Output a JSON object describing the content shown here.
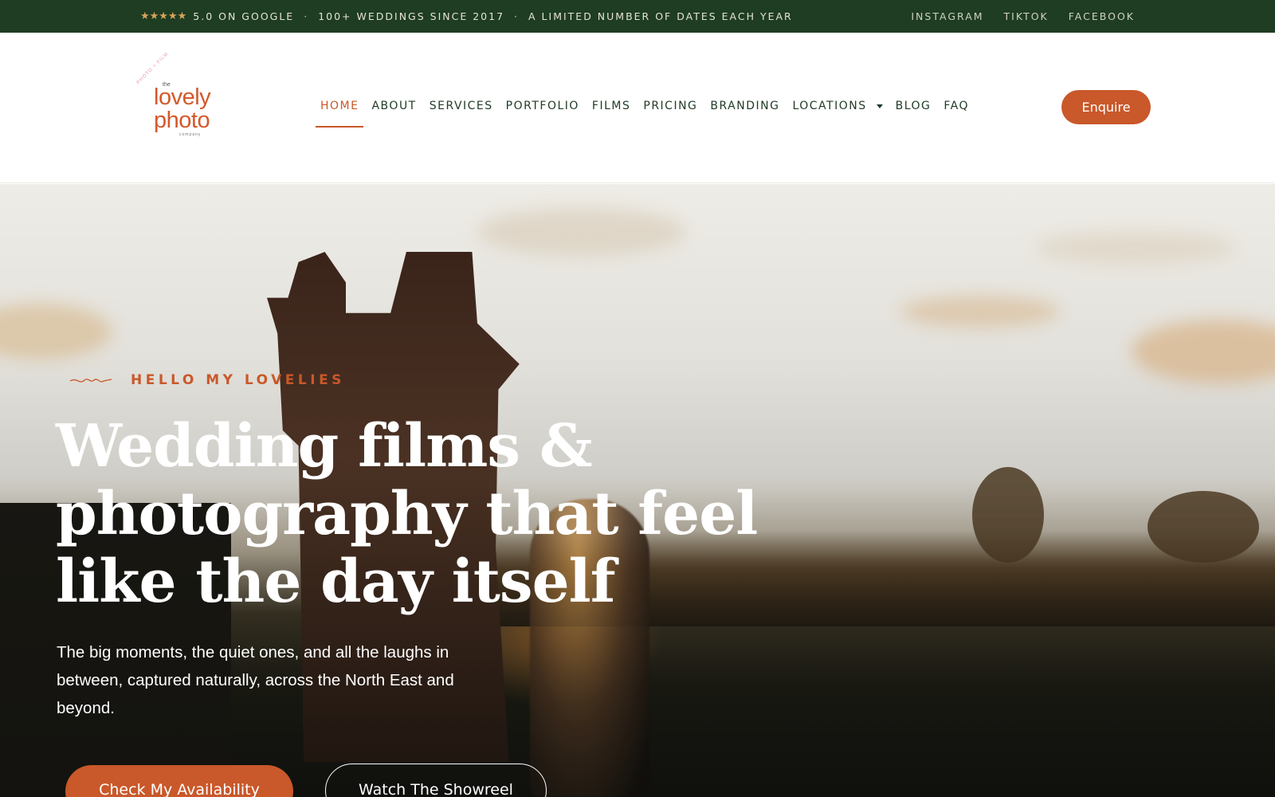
{
  "topbar": {
    "stars": "★★★★★",
    "rating": "5.0 ON GOOGLE",
    "separator": "·",
    "weddings": "100+ WEDDINGS SINCE 2017",
    "dates": "A LIMITED NUMBER OF DATES EACH YEAR",
    "social": [
      "INSTAGRAM",
      "TIKTOK",
      "FACEBOOK"
    ]
  },
  "logo": {
    "arc_text": "PHOTO + FILM",
    "the": "the",
    "line1": "lovely",
    "line2": "photo",
    "company": "company"
  },
  "nav": {
    "items": [
      "HOME",
      "ABOUT",
      "SERVICES",
      "PORTFOLIO",
      "FILMS",
      "PRICING",
      "BRANDING",
      "LOCATIONS",
      "BLOG",
      "FAQ"
    ],
    "active": "HOME"
  },
  "header": {
    "enquire_label": "Enquire"
  },
  "hero": {
    "kicker": "HELLO MY LOVELIES",
    "headline_line1": "Wedding films &",
    "headline_line2": "photography that feel",
    "headline_line3": "like the day itself",
    "lede": "The big moments, the quiet ones, and all the laughs in between, captured naturally, across the North East and beyond.",
    "primary_cta": "Check My Availability",
    "secondary_cta": "Watch The Showreel"
  },
  "colors": {
    "topbar_bg": "#1e3d22",
    "accent": "#c9582a",
    "nav_text": "#1f3a24",
    "star": "#d9a25a"
  },
  "icons": [
    "star-icon",
    "chevron-down-icon",
    "scribble-decoration-icon"
  ]
}
